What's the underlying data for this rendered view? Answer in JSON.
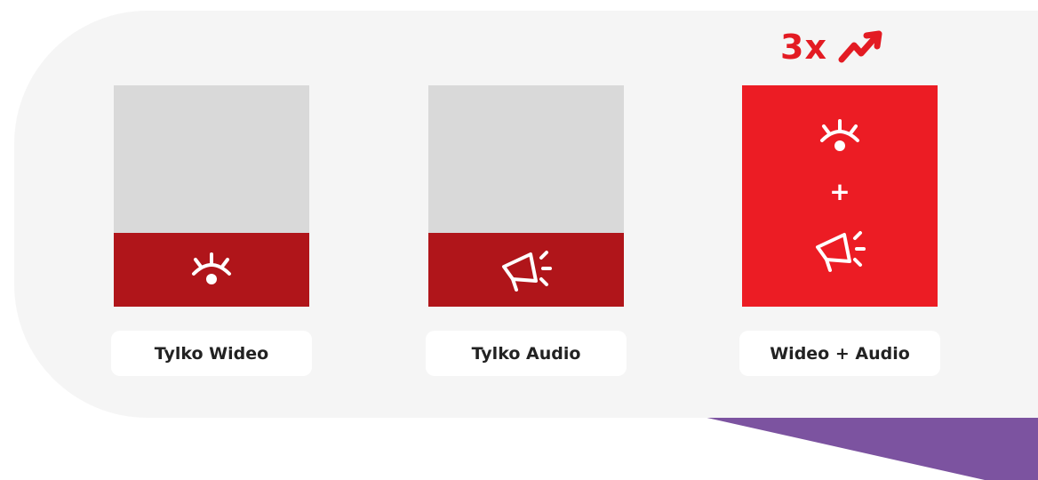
{
  "colors": {
    "panel_bg": "#f5f5f5",
    "card_gray": "#d9d9d9",
    "dark_red": "#b0151a",
    "bright_red": "#ec1c24",
    "accent_purple": "#7c53a0",
    "badge_red": "#e31b23"
  },
  "badge": {
    "text": "3x",
    "icon": "trending-up-arrow-icon"
  },
  "cards": [
    {
      "label": "Tylko Wideo",
      "icon": "eye-icon"
    },
    {
      "label": "Tylko Audio",
      "icon": "megaphone-icon"
    },
    {
      "label": "Wideo + Audio",
      "plus": "+",
      "icons": [
        "eye-icon",
        "megaphone-icon"
      ]
    }
  ]
}
